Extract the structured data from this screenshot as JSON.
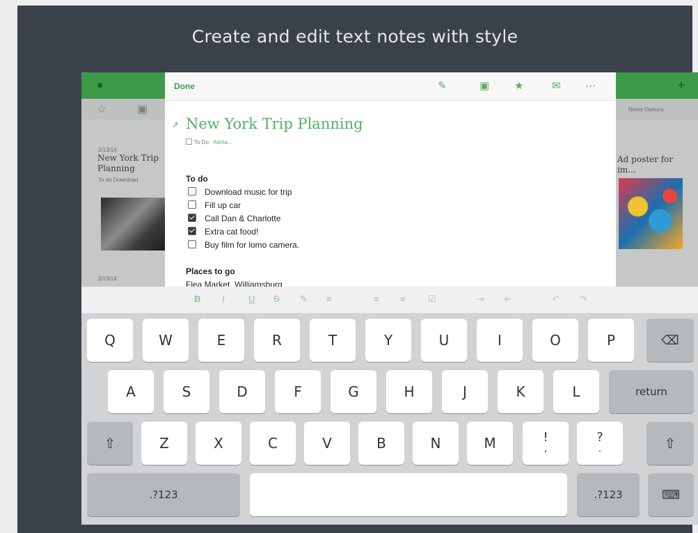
{
  "headline": "Create and edit text notes with style",
  "note": {
    "done_label": "Done",
    "title": "New York Trip Planning",
    "tag": "To Do",
    "tag_more": "Alerta...",
    "todo_header": "To do",
    "todos": [
      {
        "label": "Download music for trip",
        "checked": false
      },
      {
        "label": "Fill up car",
        "checked": false
      },
      {
        "label": "Call Dan & Charlotte",
        "checked": true
      },
      {
        "label": "Extra cat food!",
        "checked": true
      },
      {
        "label": "Buy film for lomo camera.",
        "checked": false
      }
    ],
    "places_header": "Places to go",
    "places_first": "Flea Market, Williamsburg"
  },
  "background": {
    "left_note_date": "2/13/14",
    "left_note_title": "New York Trip Planning",
    "left_note_sub": "To do  Download",
    "left_note_date2": "2/13/14",
    "right_note_title": "Ad poster for im...",
    "right_toolbar_text": "Notes   Options"
  },
  "keyboard": {
    "row1": [
      "Q",
      "W",
      "E",
      "R",
      "T",
      "Y",
      "U",
      "I",
      "O",
      "P"
    ],
    "row2": [
      "A",
      "S",
      "D",
      "F",
      "G",
      "H",
      "J",
      "K",
      "L"
    ],
    "row3": [
      "Z",
      "X",
      "C",
      "V",
      "B",
      "N",
      "M"
    ],
    "return_label": "return",
    "numbers_label": ".?123",
    "punct1": [
      "!",
      ","
    ],
    "punct2": [
      "?",
      "."
    ]
  },
  "colors": {
    "accent": "#3ea14d",
    "panel": "#3b414b"
  }
}
